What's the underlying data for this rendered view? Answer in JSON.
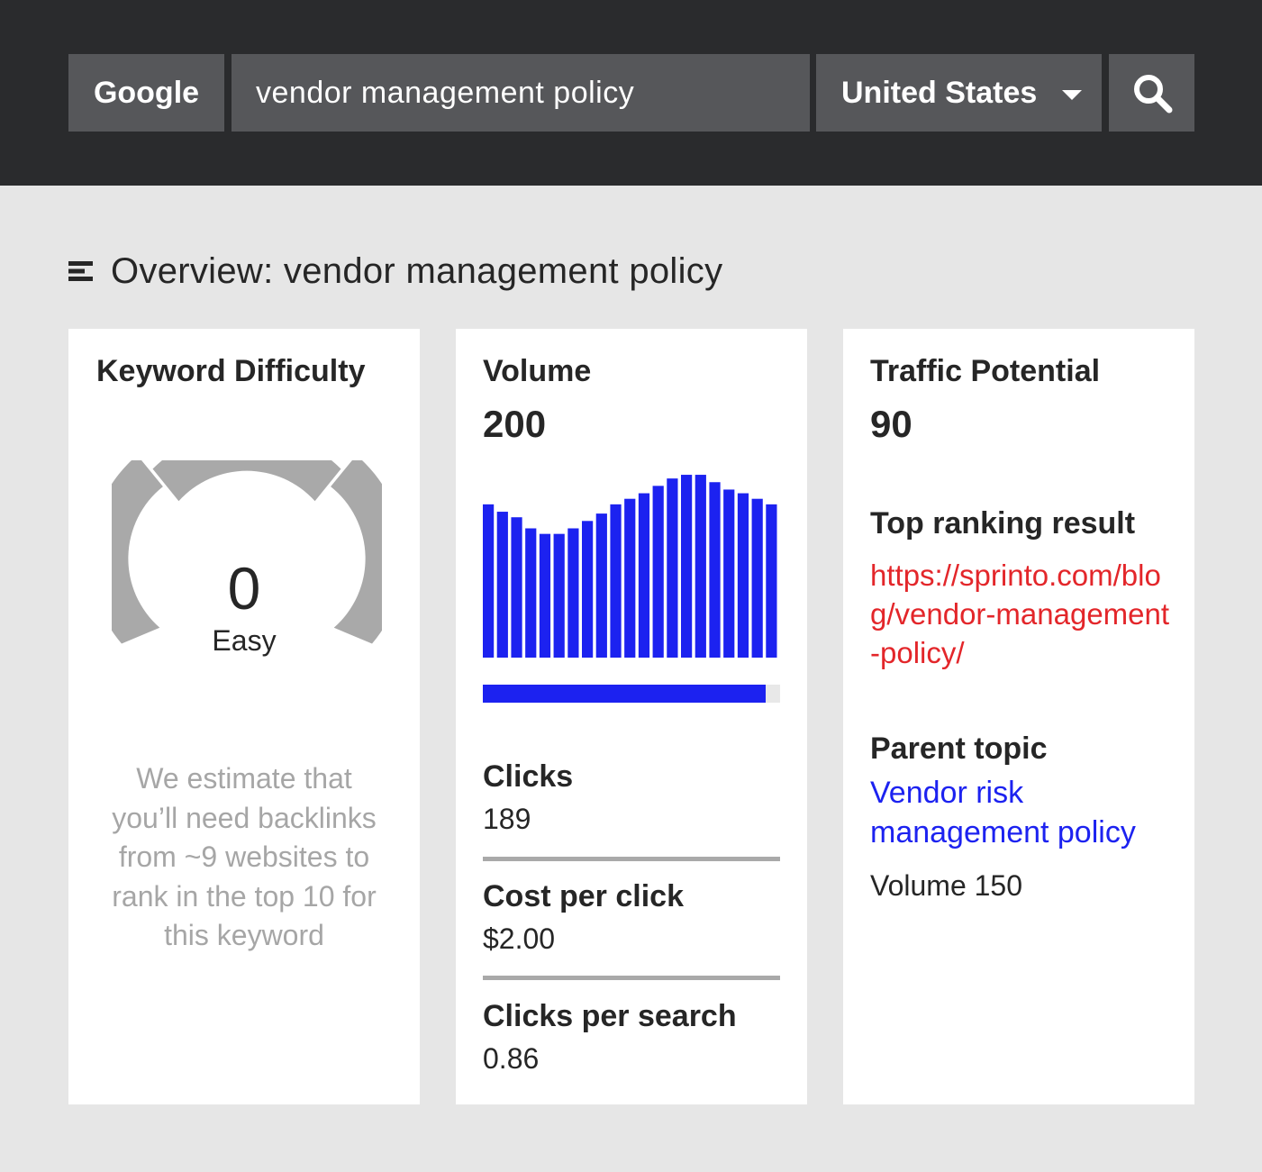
{
  "search": {
    "engine": "Google",
    "query": "vendor management policy",
    "country": "United States",
    "search_icon": "search-icon",
    "dropdown_icon": "chevron-down-icon"
  },
  "overview": {
    "icon": "menu-lines-icon",
    "title": "Overview: vendor management policy"
  },
  "keyword_difficulty": {
    "label": "Keyword Difficulty",
    "score": "0",
    "level": "Easy",
    "note": "We estimate that you’ll need backlinks from ~9 websites to rank in the top 10 for this keyword",
    "gauge_color": "#a9a9a9"
  },
  "volume": {
    "label": "Volume",
    "value": "200",
    "monthly_trend": [
      0.83,
      0.79,
      0.76,
      0.7,
      0.67,
      0.67,
      0.7,
      0.74,
      0.78,
      0.83,
      0.86,
      0.89,
      0.93,
      0.97,
      0.99,
      0.99,
      0.95,
      0.91,
      0.89,
      0.86,
      0.83
    ],
    "bar_color": "#1c22f0",
    "share_fill": 0.95,
    "clicks_label": "Clicks",
    "clicks_value": "189",
    "cpc_label": "Cost per click",
    "cpc_value": "$2.00",
    "cps_label": "Clicks per search",
    "cps_value": "0.86"
  },
  "traffic": {
    "label": "Traffic Potential",
    "value": "90",
    "top_result_label": "Top ranking result",
    "top_result_url": "https://sprinto.com/blog/vendor-management-policy/",
    "parent_topic_label": "Parent topic",
    "parent_topic": "Vendor risk management policy",
    "parent_volume": "Volume 150",
    "link_color_red": "#e3262a",
    "link_color_blue": "#1c22f0"
  }
}
